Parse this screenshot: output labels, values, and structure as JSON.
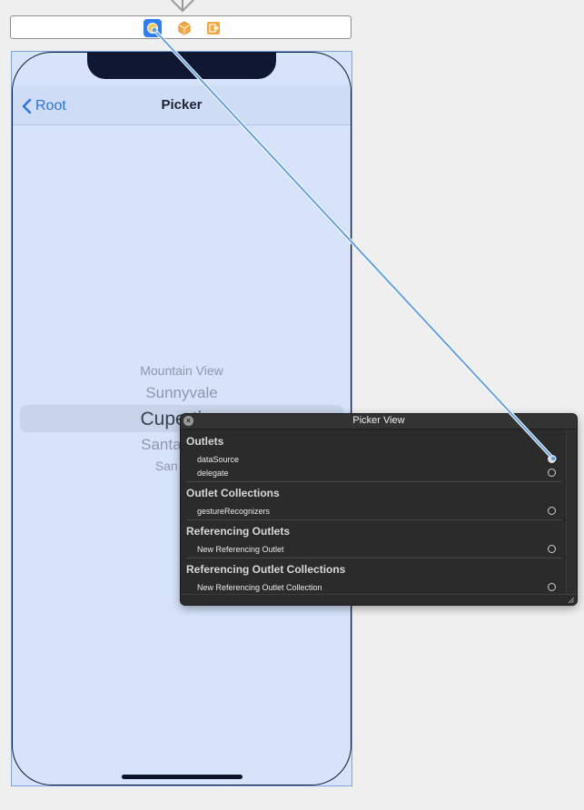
{
  "navigation_bar": {
    "back_label": "Root",
    "title": "Picker"
  },
  "picker": {
    "rows": [
      "Mountain View",
      "Sunnyvale",
      "Cupertino",
      "Santa Clara",
      "San Jose"
    ],
    "selected_index": 2
  },
  "inspector": {
    "title": "Picker View",
    "sections": [
      {
        "header": "Outlets",
        "items": [
          {
            "label": "dataSource",
            "connected": true
          },
          {
            "label": "delegate",
            "connected": false
          }
        ]
      },
      {
        "header": "Outlet Collections",
        "items": [
          {
            "label": "gestureRecognizers",
            "connected": false
          }
        ]
      },
      {
        "header": "Referencing Outlets",
        "items": [
          {
            "label": "New Referencing Outlet",
            "connected": false
          }
        ]
      },
      {
        "header": "Referencing Outlet Collections",
        "items": [
          {
            "label": "New Referencing Outlet Collection",
            "connected": false
          }
        ]
      }
    ]
  },
  "scene_dock": {
    "icons": [
      "view-controller-icon",
      "first-responder-icon",
      "exit-icon"
    ]
  },
  "colors": {
    "accent": "#2a73e8",
    "connection_line": "#5fa0e8",
    "panel_bg": "#2b2b2b",
    "device_bg": "#d6e3fb"
  }
}
